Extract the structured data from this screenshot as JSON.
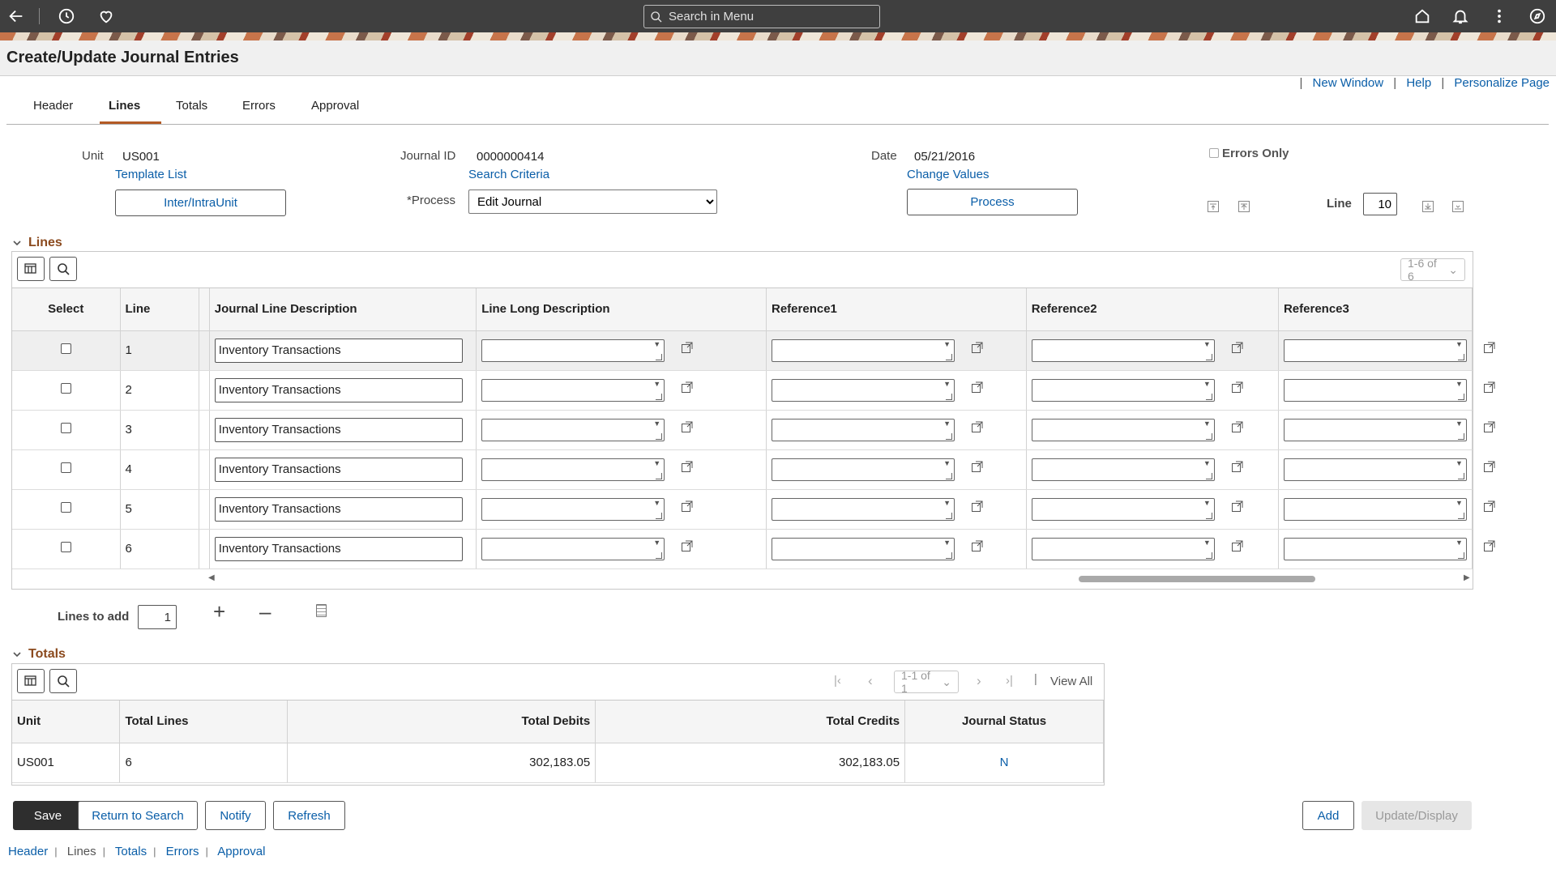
{
  "search": {
    "placeholder": "Search in Menu"
  },
  "page": {
    "title": "Create/Update Journal Entries"
  },
  "page_links": {
    "new_window": "New Window",
    "help": "Help",
    "personalize": "Personalize Page",
    "sep": "|"
  },
  "tabs": [
    {
      "label": "Header"
    },
    {
      "label": "Lines"
    },
    {
      "label": "Totals"
    },
    {
      "label": "Errors"
    },
    {
      "label": "Approval"
    }
  ],
  "header_fields": {
    "unit_label": "Unit",
    "unit_value": "US001",
    "template_list": "Template List",
    "inter_intra_unit": "Inter/IntraUnit",
    "journal_id_label": "Journal ID",
    "journal_id_value": "0000000414",
    "search_criteria": "Search Criteria",
    "process_label": "*Process",
    "process_value": "Edit Journal",
    "date_label": "Date",
    "date_value": "05/21/2016",
    "change_values": "Change Values",
    "process_button": "Process",
    "errors_only": "Errors Only",
    "line_label": "Line",
    "line_value": "10"
  },
  "lines_section": {
    "title": "Lines",
    "pager": "1-6 of 6",
    "columns": [
      "Select",
      "Line",
      "Journal Line Description",
      "Line Long Description",
      "Reference1",
      "Reference2",
      "Reference3"
    ],
    "rows": [
      {
        "line": "1",
        "description": "Inventory Transactions"
      },
      {
        "line": "2",
        "description": "Inventory Transactions"
      },
      {
        "line": "3",
        "description": "Inventory Transactions"
      },
      {
        "line": "4",
        "description": "Inventory Transactions"
      },
      {
        "line": "5",
        "description": "Inventory Transactions"
      },
      {
        "line": "6",
        "description": "Inventory Transactions"
      }
    ],
    "lines_to_add_label": "Lines to add",
    "lines_to_add_value": "1"
  },
  "totals_section": {
    "title": "Totals",
    "pager": "1-1 of 1",
    "view_all": "View All",
    "columns": [
      "Unit",
      "Total Lines",
      "Total Debits",
      "Total Credits",
      "Journal Status"
    ],
    "row": {
      "unit": "US001",
      "total_lines": "6",
      "total_debits": "302,183.05",
      "total_credits": "302,183.05",
      "journal_status": "N"
    }
  },
  "buttons": {
    "save": "Save",
    "return_to_search": "Return to Search",
    "notify": "Notify",
    "refresh": "Refresh",
    "add": "Add",
    "update_display": "Update/Display"
  },
  "bottom_links": [
    "Header",
    "Lines",
    "Totals",
    "Errors",
    "Approval"
  ],
  "colors": {
    "accent": "#b35a25",
    "link": "#0a5ea8",
    "topbar": "#3f3f3f"
  }
}
